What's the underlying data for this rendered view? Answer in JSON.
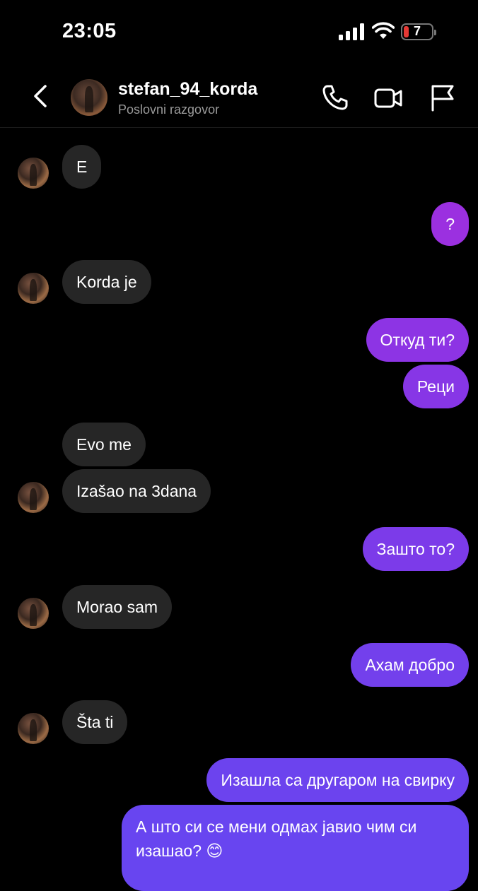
{
  "status": {
    "time": "23:05",
    "battery": "7"
  },
  "header": {
    "username": "stefan_94_korda",
    "subtitle": "Poslovni razgovor"
  },
  "messages": [
    {
      "dir": "in",
      "text": "E"
    },
    {
      "dir": "out",
      "text": "?"
    },
    {
      "dir": "in",
      "text": "Korda je"
    },
    {
      "dir": "out",
      "text": "Откуд ти?"
    },
    {
      "dir": "out",
      "text": "Реци"
    },
    {
      "dir": "in",
      "text": "Evo me"
    },
    {
      "dir": "in",
      "text": "Izašao na 3dana"
    },
    {
      "dir": "out",
      "text": "Зашто то?"
    },
    {
      "dir": "in",
      "text": "Morao sam"
    },
    {
      "dir": "out",
      "text": "Ахам добро"
    },
    {
      "dir": "in",
      "text": "Šta ti"
    },
    {
      "dir": "out",
      "text": "Изашла са другаром на свирку"
    },
    {
      "dir": "out",
      "text": "А што си се мени одмах јавио чим си изашао? 😊"
    }
  ],
  "colors": {
    "incoming": "#262626",
    "outgoing_top": "#9b30e0",
    "outgoing_bottom": "#6a44f0"
  }
}
